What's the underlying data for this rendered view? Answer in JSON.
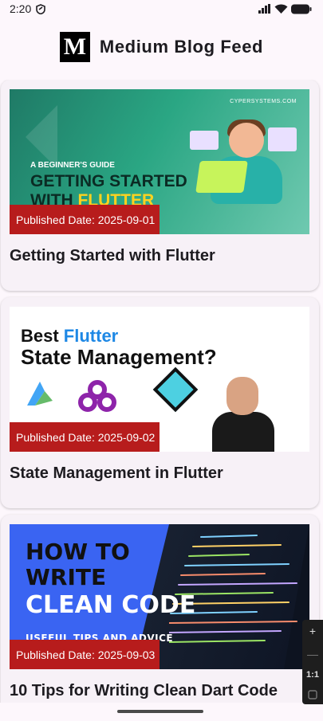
{
  "status_bar": {
    "time": "2:20",
    "icons": [
      "shield-icon",
      "signal-icon",
      "wifi-icon",
      "battery-icon"
    ]
  },
  "app_bar": {
    "logo_letter": "M",
    "title": "Medium Blog Feed"
  },
  "posts": [
    {
      "title": "Getting Started with Flutter",
      "badge": "Published Date: 2025-09-01",
      "image_text": {
        "brand": "CYPERSYSTEMS.COM",
        "kicker": "A BEGINNER'S GUIDE",
        "line1": "GETTING STARTED",
        "line2_a": "WITH ",
        "line2_b": "FLUTTER"
      }
    },
    {
      "title": "State Management in Flutter",
      "badge": "Published Date: 2025-09-02",
      "image_text": {
        "line1_a": "Best ",
        "line1_b": "Flutter",
        "line2": "State Management?"
      }
    },
    {
      "title": "10 Tips for Writing Clean Dart Code",
      "badge": "Published Date: 2025-09-03",
      "image_text": {
        "line1": "HOW TO",
        "line2": "WRITE",
        "line3": "CLEAN CODE",
        "line4": "USEFUL TIPS AND ADVICE"
      }
    }
  ],
  "zoom_panel": {
    "plus": "+",
    "minus": "—",
    "ratio": "1:1"
  },
  "colors": {
    "background": "#fdf7fc",
    "card": "#f7f1f7",
    "badge": "#b71c1c",
    "logo": "#000000"
  }
}
